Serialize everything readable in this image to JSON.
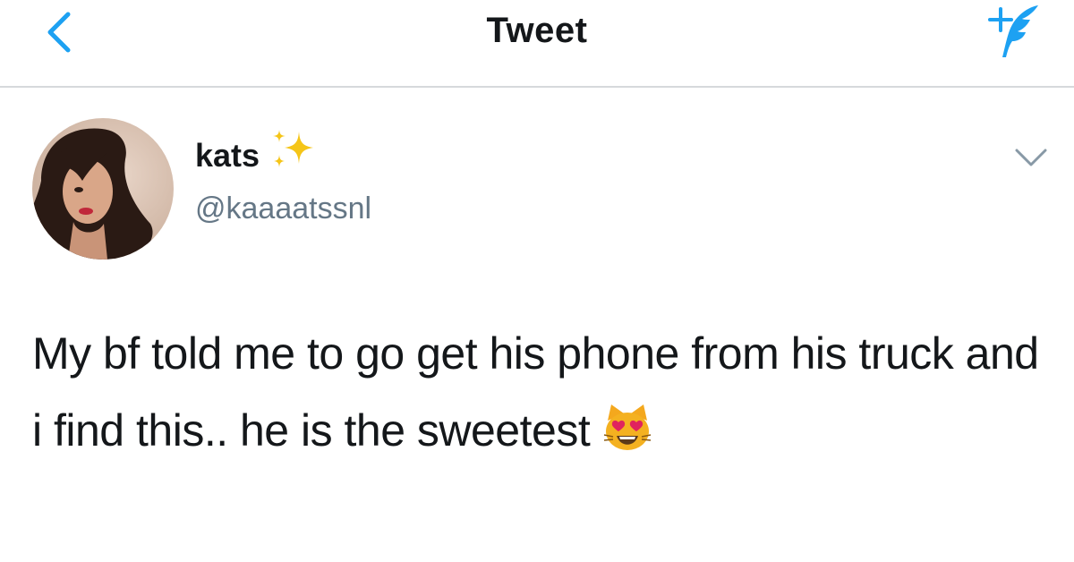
{
  "header": {
    "title": "Tweet",
    "back_icon": "chevron-left-icon",
    "compose_icon": "compose-tweet-icon",
    "accent_color": "#1da1f2"
  },
  "tweet": {
    "author": {
      "display_name": "kats",
      "name_emoji": "sparkles-icon",
      "handle": "@kaaaatssnl"
    },
    "menu_icon": "chevron-down-icon",
    "text": "My bf told me to go get his phone from his truck and i find this.. he is the sweetest",
    "trailing_emoji": "smiling-cat-heart-eyes-icon"
  }
}
